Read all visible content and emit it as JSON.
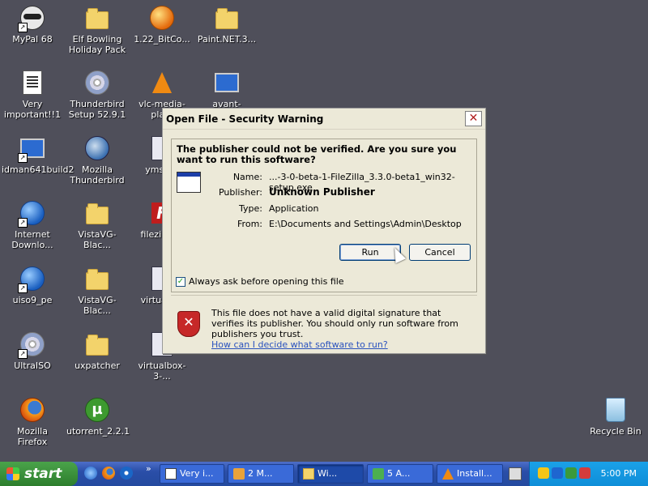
{
  "desktop": {
    "icons": [
      {
        "label": "MyPal 68"
      },
      {
        "label": "Elf Bowling Holiday Pack"
      },
      {
        "label": "1.22_BitCo..."
      },
      {
        "label": "Paint.NET.3..."
      },
      {
        "label": "Very important!!1"
      },
      {
        "label": "Thunderbird Setup 52.9.1"
      },
      {
        "label": "vlc-media-pla..."
      },
      {
        "label": "avant-brows..."
      },
      {
        "label": "idman641build2"
      },
      {
        "label": "Mozilla Thunderbird"
      },
      {
        "label": "ymsgr9"
      },
      {
        "label": "Internet Downlo..."
      },
      {
        "label": "VistaVG-Blac..."
      },
      {
        "label": "filezilla-..."
      },
      {
        "label": "uiso9_pe"
      },
      {
        "label": "VistaVG-Blac..."
      },
      {
        "label": "virtualb..."
      },
      {
        "label": "UltraISO"
      },
      {
        "label": "uxpatcher"
      },
      {
        "label": "virtualbox-3-..."
      },
      {
        "label": "Mozilla Firefox"
      },
      {
        "label": "utorrent_2.2.1"
      },
      {
        "label": "Recycle Bin"
      }
    ]
  },
  "dialog": {
    "title": "Open File - Security Warning",
    "close_glyph": "✕",
    "heading": "The publisher could not be verified.  Are you sure you want to run this software?",
    "fields": {
      "name_label": "Name:",
      "name_value": "...-3-0-beta-1-FileZilla_3.3.0-beta1_win32-setup.exe",
      "publisher_label": "Publisher:",
      "publisher_value": "Unknown Publisher",
      "type_label": "Type:",
      "type_value": "Application",
      "from_label": "From:",
      "from_value": "E:\\Documents and Settings\\Admin\\Desktop"
    },
    "run_label": "Run",
    "cancel_label": "Cancel",
    "always_ask_label": "Always ask before opening this file",
    "always_ask_checked": true,
    "check_glyph": "✓",
    "shield_glyph": "✕",
    "warning_text": "This file does not have a valid digital signature that verifies its publisher.  You should only run software from publishers you trust.",
    "help_link": "How can I decide what software to run?"
  },
  "taskbar": {
    "start_label": "start",
    "chevron": "»",
    "tasks": [
      {
        "label": "Very i..."
      },
      {
        "label": "2 M..."
      },
      {
        "label": "Wi..."
      },
      {
        "label": "5 A..."
      },
      {
        "label": "Install..."
      }
    ],
    "clock": "5:00 PM"
  },
  "colors": {
    "desktop_bg": "#4f4f5a",
    "taskbar_blue": "#2a4ea8",
    "start_green": "#3a8f3a",
    "tray_blue": "#1aa1e8"
  }
}
